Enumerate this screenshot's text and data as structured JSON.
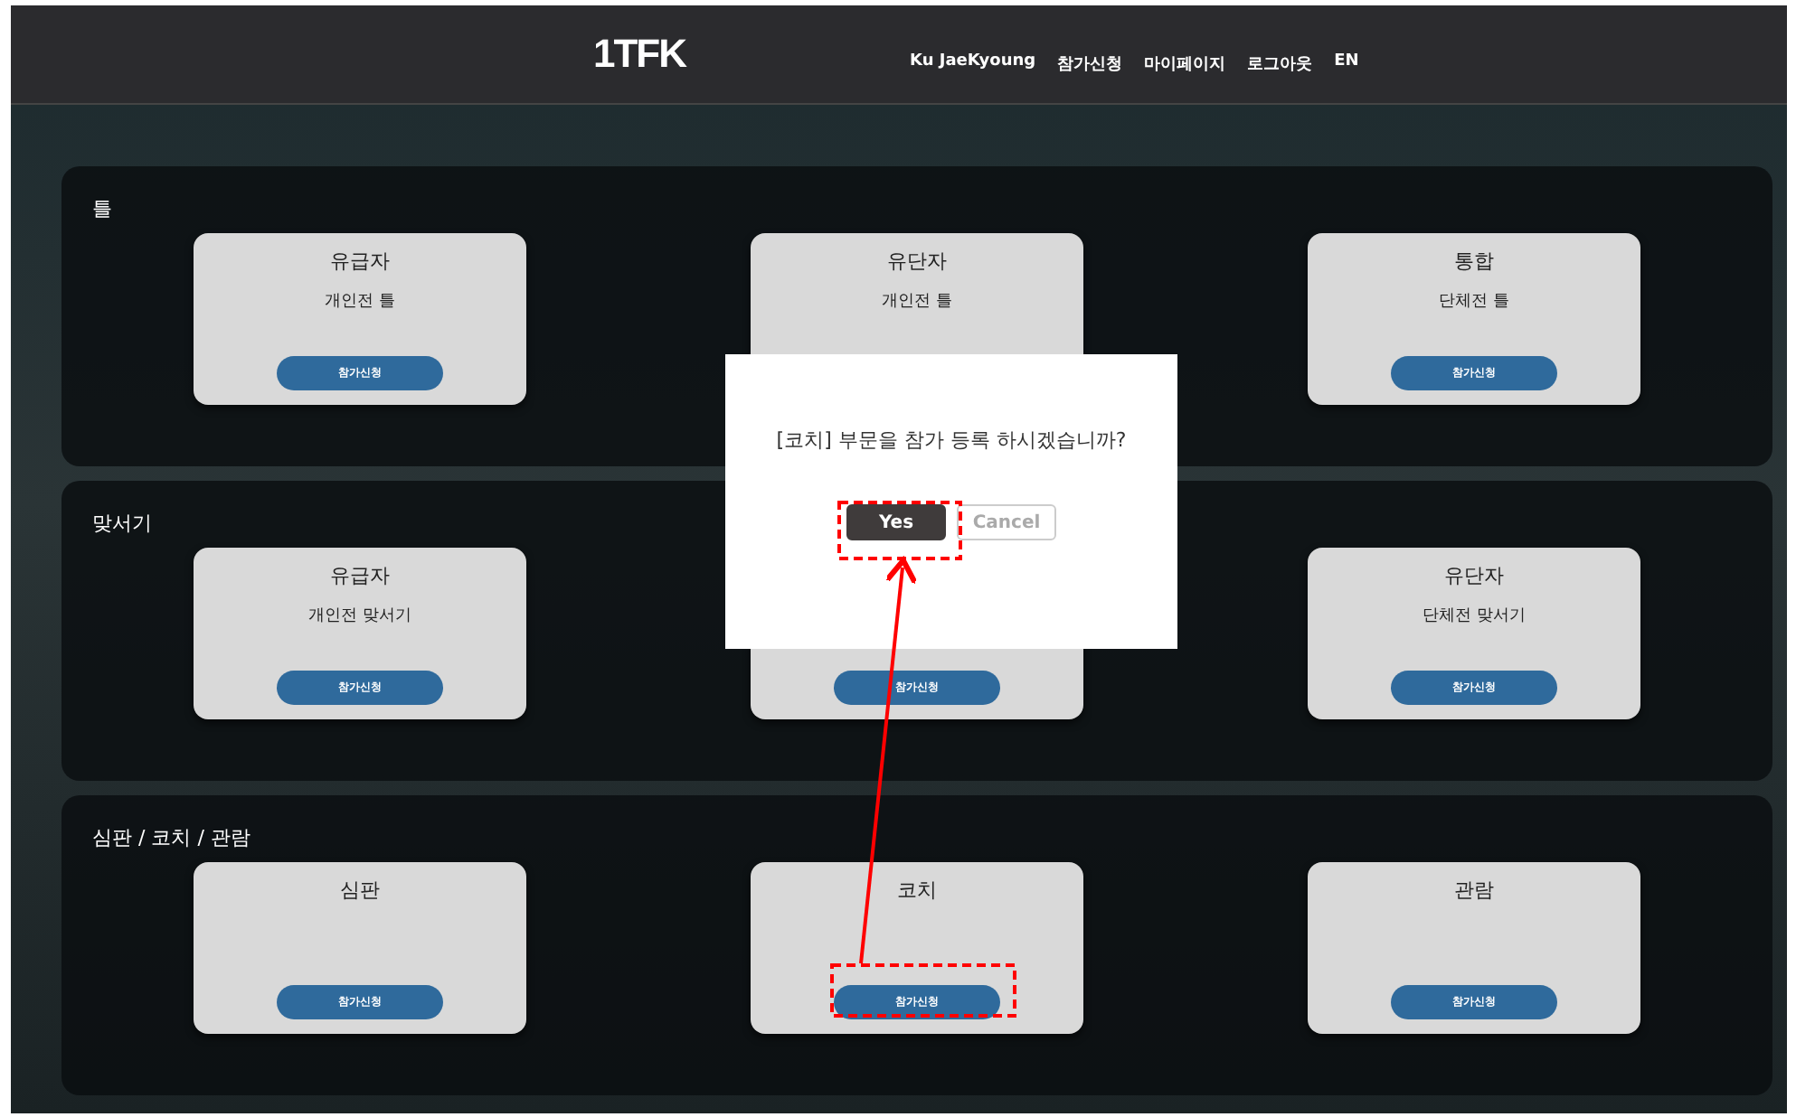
{
  "header": {
    "logo": "1TFK",
    "nav": [
      {
        "label": "Ku JaeKyoung"
      },
      {
        "label": "참가신청"
      },
      {
        "label": "마이페이지"
      },
      {
        "label": "로그아웃"
      },
      {
        "label": "EN"
      }
    ]
  },
  "sections": [
    {
      "title": "틀",
      "cards": [
        {
          "title": "유급자",
          "subtitle": "개인전 틀",
          "button": "참가신청"
        },
        {
          "title": "유단자",
          "subtitle": "개인전 틀"
        },
        {
          "title": "통합",
          "subtitle": "단체전 틀",
          "button": "참가신청"
        }
      ]
    },
    {
      "title": "맞서기",
      "cards": [
        {
          "title": "유급자",
          "subtitle": "개인전 맞서기",
          "button": "참가신청"
        },
        {
          "button": "참가신청"
        },
        {
          "title": "유단자",
          "subtitle": "단체전 맞서기",
          "button": "참가신청"
        }
      ]
    },
    {
      "title": "심판 / 코치 / 관람",
      "cards": [
        {
          "title": "심판",
          "button": "참가신청"
        },
        {
          "title": "코치",
          "button": "참가신청"
        },
        {
          "title": "관람",
          "button": "참가신청"
        }
      ]
    }
  ],
  "modal": {
    "message": "[코치] 부문을 참가 등록 하시겠습니까?",
    "buttons": [
      {
        "label": "Yes",
        "kind": "primary"
      },
      {
        "label": "Cancel",
        "kind": "secondary"
      }
    ]
  }
}
